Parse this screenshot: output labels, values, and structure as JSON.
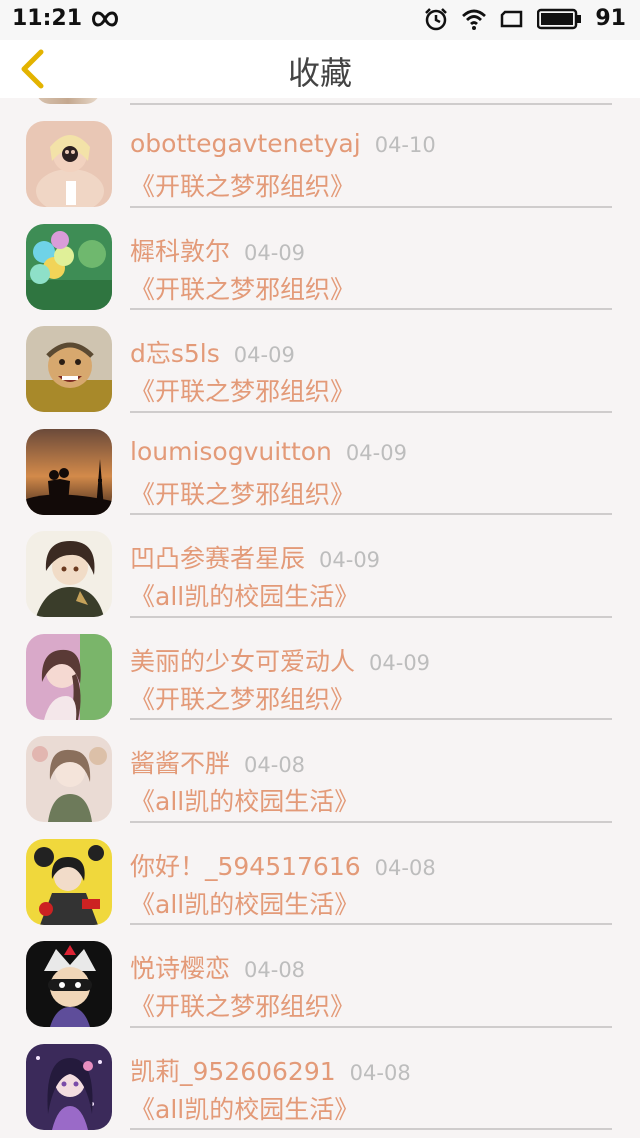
{
  "status_bar": {
    "time": "11:21",
    "battery_percent": "91",
    "icons": [
      "link-icon",
      "alarm-icon",
      "wifi-icon",
      "window-icon",
      "battery-icon"
    ]
  },
  "header": {
    "title": "收藏",
    "back_icon": "chevron-left-icon"
  },
  "colors": {
    "accent": "#e39a78",
    "date": "#bdbdbd",
    "back_icon": "#e3b300"
  },
  "items": [
    {
      "user": "obottegavtenetyaj",
      "date": "04-10",
      "book": "《开联之梦邪组织》"
    },
    {
      "user": "樨科敦尔",
      "date": "04-09",
      "book": "《开联之梦邪组织》"
    },
    {
      "user": "d忘s5ls",
      "date": "04-09",
      "book": "《开联之梦邪组织》"
    },
    {
      "user": "loumisogvuitton",
      "date": "04-09",
      "book": "《开联之梦邪组织》"
    },
    {
      "user": "凹凸参赛者星辰",
      "date": "04-09",
      "book": "《all凯的校园生活》"
    },
    {
      "user": "美丽的少女可爱动人",
      "date": "04-09",
      "book": "《开联之梦邪组织》"
    },
    {
      "user": "酱酱不胖",
      "date": "04-08",
      "book": "《all凯的校园生活》"
    },
    {
      "user": "你好！_594517616",
      "date": "04-08",
      "book": "《all凯的校园生活》"
    },
    {
      "user": "悦诗樱恋",
      "date": "04-08",
      "book": "《开联之梦邪组织》"
    },
    {
      "user": "凯莉_952606291",
      "date": "04-08",
      "book": "《all凯的校园生活》"
    }
  ]
}
